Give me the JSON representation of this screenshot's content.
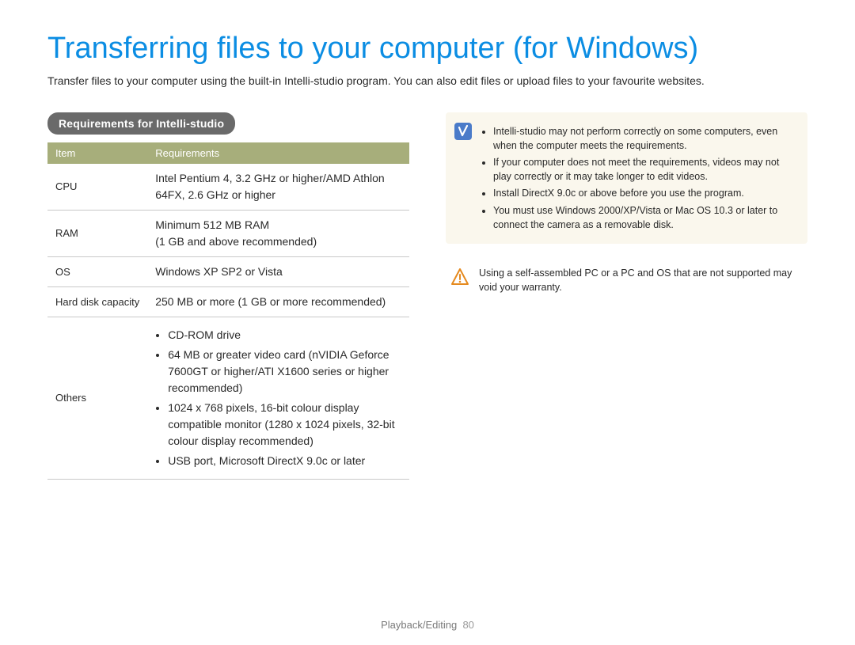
{
  "page": {
    "title": "Transferring files to your computer (for Windows)",
    "intro": "Transfer files to your computer using the built-in Intelli-studio program. You can also edit files or upload files to your favourite websites.",
    "footer_section": "Playback/Editing",
    "footer_page": "80"
  },
  "requirements": {
    "heading": "Requirements for Intelli-studio",
    "columns": {
      "item": "Item",
      "req": "Requirements"
    },
    "rows": [
      {
        "label": "CPU",
        "value": "Intel Pentium 4, 3.2 GHz or higher/AMD Athlon 64FX, 2.6 GHz or higher"
      },
      {
        "label": "RAM",
        "value": "Minimum 512 MB RAM\n(1 GB and above recommended)"
      },
      {
        "label": "OS",
        "value": "Windows XP SP2 or Vista"
      },
      {
        "label": "Hard disk capacity",
        "value": "250 MB or more (1 GB or more recommended)"
      }
    ],
    "others_label": "Others",
    "others_items": [
      "CD-ROM drive",
      "64 MB or greater video card (nVIDIA Geforce 7600GT or higher/ATI X1600 series or higher recommended)",
      "1024 x 768 pixels, 16-bit colour display compatible monitor (1280 x 1024 pixels, 32-bit colour display recommended)",
      "USB port, Microsoft DirectX 9.0c or later"
    ]
  },
  "info_note": {
    "items": [
      "Intelli-studio may not perform correctly on some computers, even when the computer meets the requirements.",
      "If your computer does not meet the requirements, videos may not play correctly or it may take longer to edit videos.",
      "Install DirectX 9.0c or above before you use the program.",
      "You must use Windows 2000/XP/Vista or Mac OS 10.3 or later to connect the camera as a removable disk."
    ]
  },
  "warning_note": {
    "text": "Using a self-assembled PC or a PC and OS that are not supported may void your warranty."
  }
}
